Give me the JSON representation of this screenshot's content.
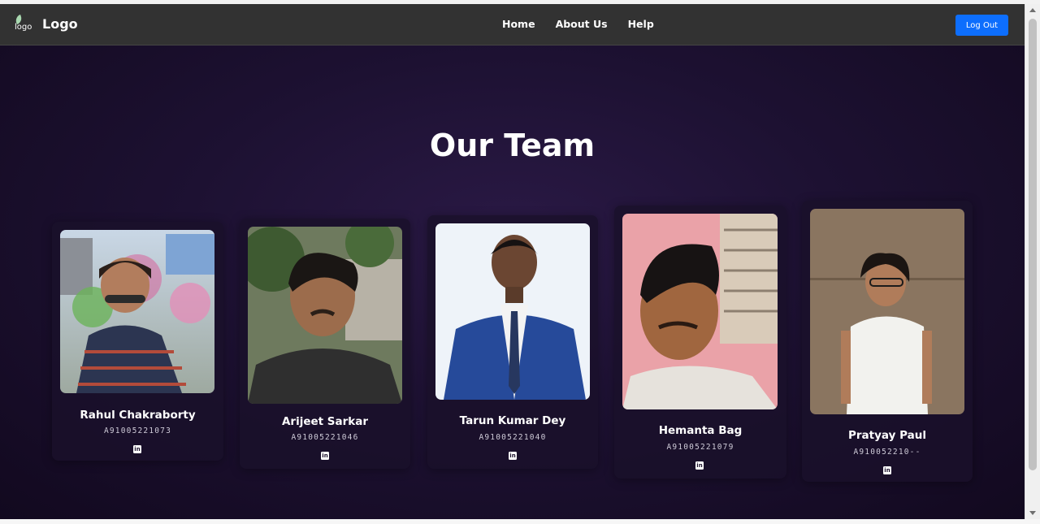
{
  "navbar": {
    "logo_icon_text": "logo",
    "brand": "Logo",
    "links": [
      "Home",
      "About Us",
      "Help"
    ],
    "logout_label": "Log Out"
  },
  "page_title": "Our Team",
  "team": [
    {
      "name": "Rahul Chakraborty",
      "id": "A91005221073",
      "social_icon": "linkedin-icon"
    },
    {
      "name": "Arijeet Sarkar",
      "id": "A91005221046",
      "social_icon": "linkedin-icon"
    },
    {
      "name": "Tarun Kumar Dey",
      "id": "A91005221040",
      "social_icon": "linkedin-icon"
    },
    {
      "name": "Hemanta Bag",
      "id": "A91005221079",
      "social_icon": "linkedin-icon"
    },
    {
      "name": "Pratyay Paul",
      "id": "A910052210--",
      "social_icon": "linkedin-icon"
    }
  ],
  "colors": {
    "navbar_bg": "#323232",
    "page_bg": "#1d1132",
    "logout_button": "#0d6efd"
  }
}
